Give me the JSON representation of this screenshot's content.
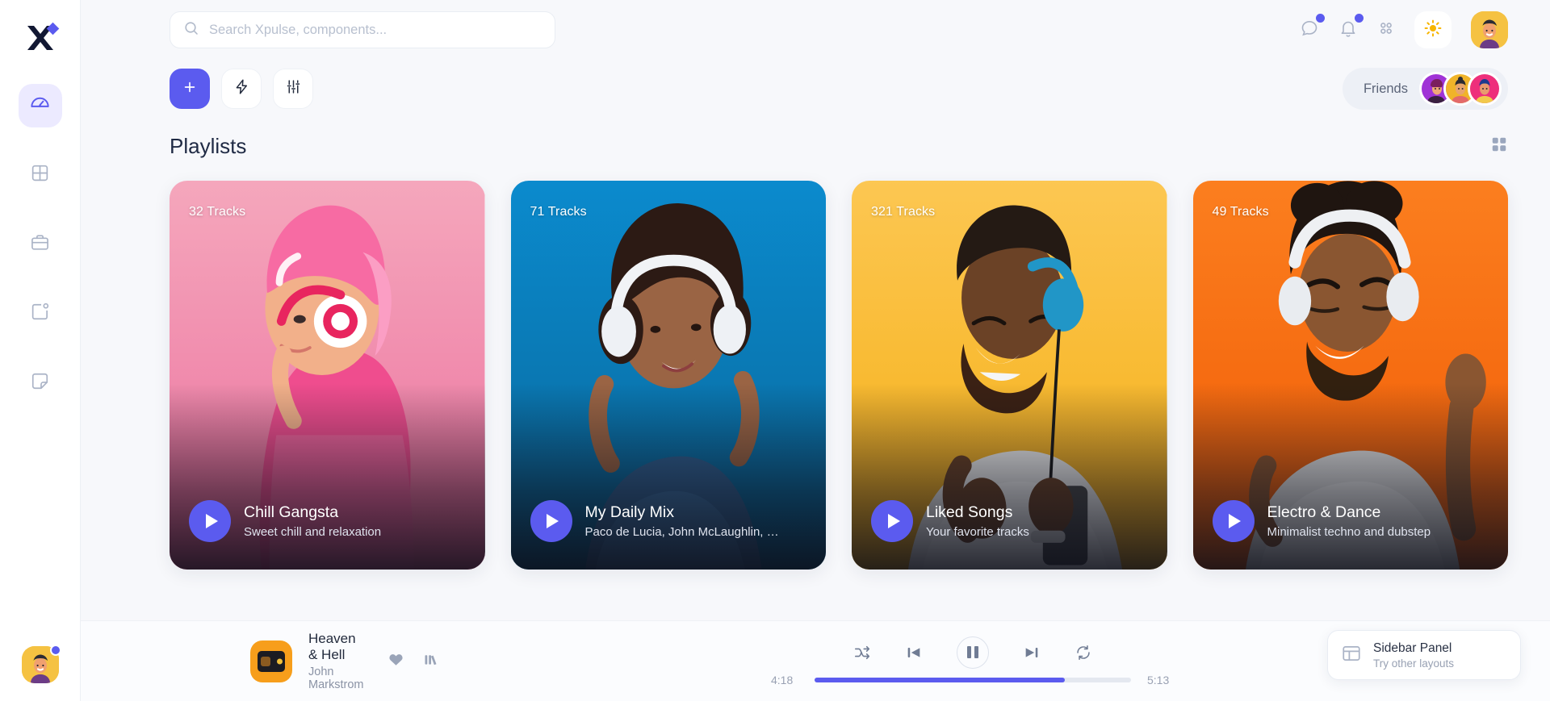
{
  "app": {
    "name": "Xpulse",
    "logo_icon": "x-diamond-logo"
  },
  "sidebar": {
    "items": [
      {
        "label": "Dashboard",
        "icon": "gauge-icon",
        "active": true
      },
      {
        "label": "Apps",
        "icon": "grid-icon",
        "active": false
      },
      {
        "label": "Projects",
        "icon": "briefcase-icon",
        "active": false
      },
      {
        "label": "Tasks",
        "icon": "square-notification-icon",
        "active": false
      },
      {
        "label": "Notes",
        "icon": "sticker-icon",
        "active": false
      }
    ],
    "profile": {
      "icon": "user-avatar",
      "status": "online"
    }
  },
  "search": {
    "placeholder": "Search Xpulse, components...",
    "value": "",
    "icon": "search-icon"
  },
  "topbar": {
    "actions": [
      {
        "name": "messages",
        "icon": "chat-bubble-icon",
        "badge": true
      },
      {
        "name": "notifications",
        "icon": "bell-icon",
        "badge": true
      },
      {
        "name": "apps",
        "icon": "four-dots-icon",
        "badge": false
      },
      {
        "name": "theme",
        "icon": "sun-icon",
        "badge": false
      }
    ],
    "avatar_icon": "user-avatar"
  },
  "toolbar": {
    "buttons": [
      {
        "name": "add",
        "icon": "plus-icon",
        "primary": true
      },
      {
        "name": "quick-actions",
        "icon": "bolt-icon",
        "primary": false
      },
      {
        "name": "filters",
        "icon": "sliders-icon",
        "primary": false
      }
    ],
    "friends_label": "Friends",
    "friends": [
      {
        "bg": "#a033d6"
      },
      {
        "bg": "#f0b429"
      },
      {
        "bg": "#ee2f7b"
      }
    ]
  },
  "section": {
    "title": "Playlists",
    "view_toggle_icon": "grid-view-icon"
  },
  "playlists": [
    {
      "tracks": "32 Tracks",
      "name": "Chill Gangsta",
      "subtitle": "Sweet chill and relaxation",
      "bg_top": "#f4a7bb",
      "bg_bottom": "#ef7fa6",
      "accent": "#e8407c"
    },
    {
      "tracks": "71 Tracks",
      "name": "My Daily Mix",
      "subtitle": "Paco de Lucia, John McLaughlin, …",
      "bg_top": "#0a87c8",
      "bg_bottom": "#0a6ea6",
      "accent": "#2a5f8f"
    },
    {
      "tracks": "321 Tracks",
      "name": "Liked Songs",
      "subtitle": "Your favorite tracks",
      "bg_top": "#fbc54a",
      "bg_bottom": "#f6b328",
      "accent": "#d99b18"
    },
    {
      "tracks": "49 Tracks",
      "name": "Electro & Dance",
      "subtitle": "Minimalist techno and dubstep",
      "bg_top": "#fb7a18",
      "bg_bottom": "#f05f0d",
      "accent": "#d24e08"
    }
  ],
  "player": {
    "track_title": "Heaven & Hell",
    "artist": "John Markstrom",
    "album_icon": "vinyl-record-icon",
    "like_icon": "heart-icon",
    "queue_icon": "library-bars-icon",
    "controls": [
      {
        "name": "shuffle",
        "icon": "shuffle-icon"
      },
      {
        "name": "previous",
        "icon": "skip-back-icon"
      },
      {
        "name": "play-pause",
        "icon": "pause-icon"
      },
      {
        "name": "next",
        "icon": "skip-forward-icon"
      },
      {
        "name": "repeat",
        "icon": "repeat-icon"
      }
    ],
    "current_time": "4:18",
    "total_time": "5:13",
    "progress_percent": 79
  },
  "hint": {
    "title": "Sidebar Panel",
    "subtitle": "Try other layouts",
    "icon": "layout-panel-icon"
  },
  "colors": {
    "accent": "#5b5bef",
    "page_bg": "#f7f8fb",
    "panel_bg": "#ffffff",
    "text": "#1f2a44",
    "muted": "#8b93a5"
  }
}
